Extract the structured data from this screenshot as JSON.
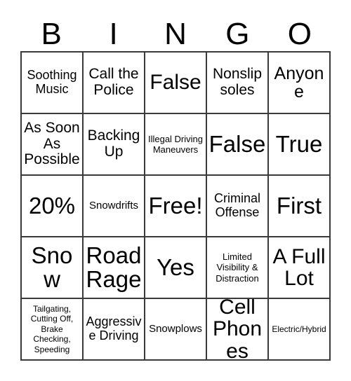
{
  "card": {
    "title": "BINGO",
    "header_letters": [
      "B",
      "I",
      "N",
      "G",
      "O"
    ],
    "colors": {
      "background": "#ffffff",
      "grid_line": "#3a3a3a",
      "text": "#000000"
    },
    "grid": {
      "columns": 5,
      "rows": 5,
      "free_space_index": 12
    },
    "cells": [
      {
        "text": "Soothing Music",
        "size": "s"
      },
      {
        "text": "Call the Police",
        "size": "m"
      },
      {
        "text": "False",
        "size": "xl"
      },
      {
        "text": "Nonslip soles",
        "size": "m"
      },
      {
        "text": "Anyone",
        "size": "l"
      },
      {
        "text": "As Soon As Possible",
        "size": "m"
      },
      {
        "text": "Backing Up",
        "size": "m"
      },
      {
        "text": "Illegal Driving Maneuvers",
        "size": "xxs"
      },
      {
        "text": "False",
        "size": "xxl"
      },
      {
        "text": "True",
        "size": "xxl"
      },
      {
        "text": "20%",
        "size": "xxl"
      },
      {
        "text": "Snowdrifts",
        "size": "xs"
      },
      {
        "text": "Free!",
        "size": "xxl"
      },
      {
        "text": "Criminal Offense",
        "size": "s"
      },
      {
        "text": "First",
        "size": "xxl"
      },
      {
        "text": "Snow",
        "size": "xxl"
      },
      {
        "text": "Road Rage",
        "size": "xxl"
      },
      {
        "text": "Yes",
        "size": "xxl"
      },
      {
        "text": "Limited Visibility & Distraction",
        "size": "xxs"
      },
      {
        "text": "A Full Lot",
        "size": "xl"
      },
      {
        "text": "Tailgating, Cutting Off, Brake Checking, Speeding",
        "size": "tiny"
      },
      {
        "text": "Aggressive Driving",
        "size": "s"
      },
      {
        "text": "Snowplows",
        "size": "xs"
      },
      {
        "text": "Cell Phones",
        "size": "xl"
      },
      {
        "text": "Electric/Hybrid",
        "size": "tiny"
      }
    ]
  }
}
